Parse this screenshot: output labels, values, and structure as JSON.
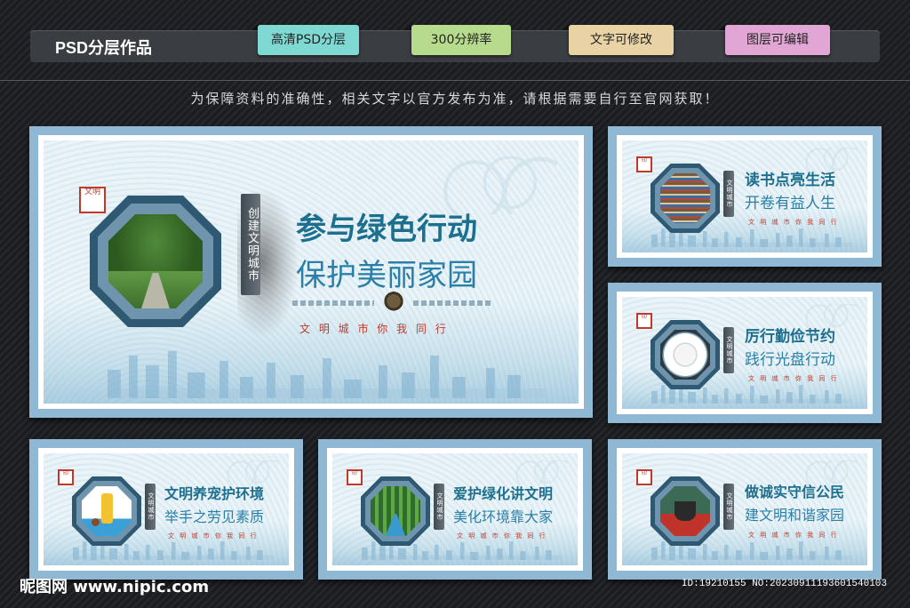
{
  "header": {
    "title": "PSD分层作品",
    "tags": [
      {
        "label": "高清PSD分层",
        "color": "#7fd9d3"
      },
      {
        "label": "300分辨率",
        "color": "#b6db8d"
      },
      {
        "label": "文字可修改",
        "color": "#e9d2a3"
      },
      {
        "label": "图层可编辑",
        "color": "#e2a6d5"
      }
    ]
  },
  "notice": "为保障资料的准确性，相关文字以官方发布为准，请根据需要自行至官网获取！",
  "main_card": {
    "title": "参与绿色行动",
    "subtitle": "保护美丽家园",
    "vertical": "创建文明城市",
    "slogan": "文 明 城 市     你 我 同 行"
  },
  "cards": [
    {
      "title": "读书点亮生活",
      "subtitle": "开卷有益人生",
      "slogan": "文 明 城 市   你 我 同 行"
    },
    {
      "title": "厉行勤俭节约",
      "subtitle": "践行光盘行动",
      "slogan": "文 明 城 市   你 我 同 行"
    },
    {
      "title": "文明养宠护环境",
      "subtitle": "举手之劳见素质",
      "slogan": "文 明 城 市   你 我 同 行"
    },
    {
      "title": "爱护绿化讲文明",
      "subtitle": "美化环境靠大家",
      "slogan": "文 明 城 市   你 我 同 行"
    },
    {
      "title": "做诚实守信公民",
      "subtitle": "建文明和谐家园",
      "slogan": "文 明 城 市   你 我 同 行"
    }
  ],
  "footer": {
    "watermark": "昵图网 www.nipic.com",
    "id": "ID:19210155 NO:20230911193601540103"
  },
  "colors": {
    "frame": "#8fb8d4",
    "title_text": "#1d6f8f",
    "slogan_red": "#c0392b"
  }
}
